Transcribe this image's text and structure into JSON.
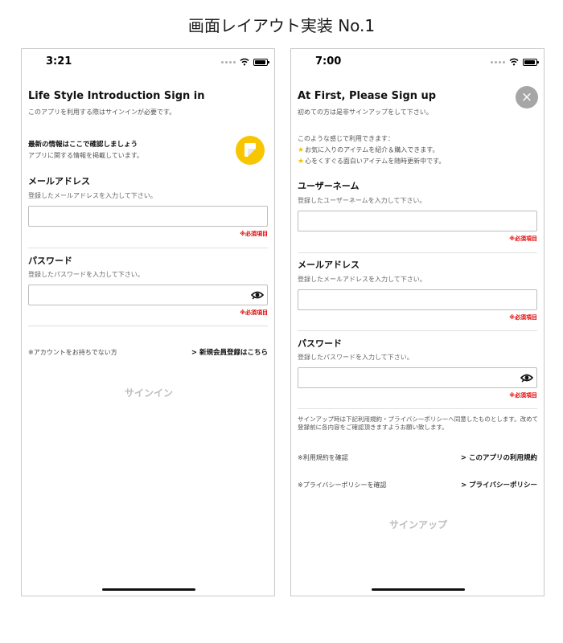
{
  "header": {
    "title": "画面レイアウト実装 No.1"
  },
  "colors": {
    "accent_yellow": "#f7c600",
    "required_red": "#e00000",
    "button_disabled": "#bdbdbd",
    "close_gray": "#a6a6a6"
  },
  "icons": {
    "signal": "signal-dots-icon",
    "wifi": "wifi-icon",
    "battery": "battery-icon",
    "eye": "eye-icon",
    "note": "note-icon",
    "close": "close-icon",
    "star": "star-icon"
  },
  "signin": {
    "status_time": "3:21",
    "title": "Life Style Introduction Sign in",
    "subtitle": "このアプリを利用する際はサインインが必要です。",
    "info_title": "最新の情報はここで確認しましょう",
    "info_sub": "アプリに関する情報を掲載しています。",
    "email": {
      "label": "メールアドレス",
      "hint": "登録したメールアドレスを入力して下さい。",
      "value": "",
      "required": "※必須項目"
    },
    "password": {
      "label": "パスワード",
      "hint": "登録したパスワードを入力して下さい。",
      "value": "",
      "required": "※必須項目"
    },
    "no_account": "※アカウントをお持ちでない方",
    "register_link": "> 新規会員登録はこちら",
    "submit": "サインイン"
  },
  "signup": {
    "status_time": "7:00",
    "title": "At First, Please Sign up",
    "subtitle": "初めての方は是非サインアップをして下さい。",
    "usage_intro": "このような感じで利用できます：",
    "usage_items": [
      "お気に入りのアイテムを紹介＆購入できます。",
      "心をくすぐる面白いアイテムを随時更新中です。"
    ],
    "username": {
      "label": "ユーザーネーム",
      "hint": "登録したユーザーネームを入力して下さい。",
      "value": "",
      "required": "※必須項目"
    },
    "email": {
      "label": "メールアドレス",
      "hint": "登録したメールアドレスを入力して下さい。",
      "value": "",
      "required": "※必須項目"
    },
    "password": {
      "label": "パスワード",
      "hint": "登録したパスワードを入力して下さい。",
      "value": "",
      "required": "※必須項目"
    },
    "terms_note": "サインアップ時は下記利用規約・プライバシーポリシーへ同意したものとします。改めて登録前に各内容をご確認頂きますようお願い致します。",
    "terms_check": "※利用規約を確認",
    "terms_link": "> このアプリの利用規約",
    "privacy_check": "※プライバシーポリシーを確認",
    "privacy_link": "> プライバシーポリシー",
    "submit": "サインアップ",
    "close": "×"
  }
}
